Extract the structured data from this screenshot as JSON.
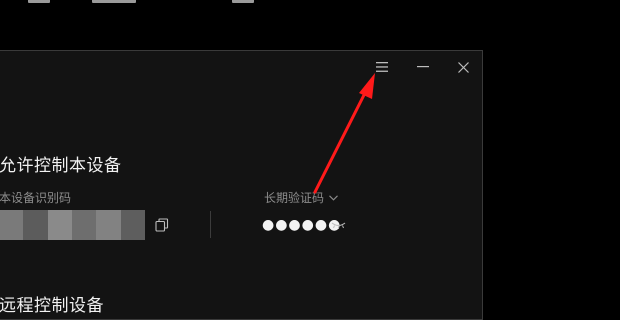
{
  "section_allow": {
    "title": "允许控制本设备"
  },
  "device_id": {
    "label": "本设备识别码"
  },
  "verify_code": {
    "label": "长期验证码",
    "masked_value": "●●●●●●"
  },
  "section_remote": {
    "title": "远程控制设备"
  },
  "window_controls": {
    "menu_icon": "hamburger-menu-icon",
    "minimize_icon": "minimize-icon",
    "close_icon": "close-icon"
  },
  "annotation": {
    "color": "#ff1a1a"
  },
  "colors": {
    "window_bg": "#131313",
    "text": "#f2f2f2",
    "muted": "#8c8c8c"
  }
}
